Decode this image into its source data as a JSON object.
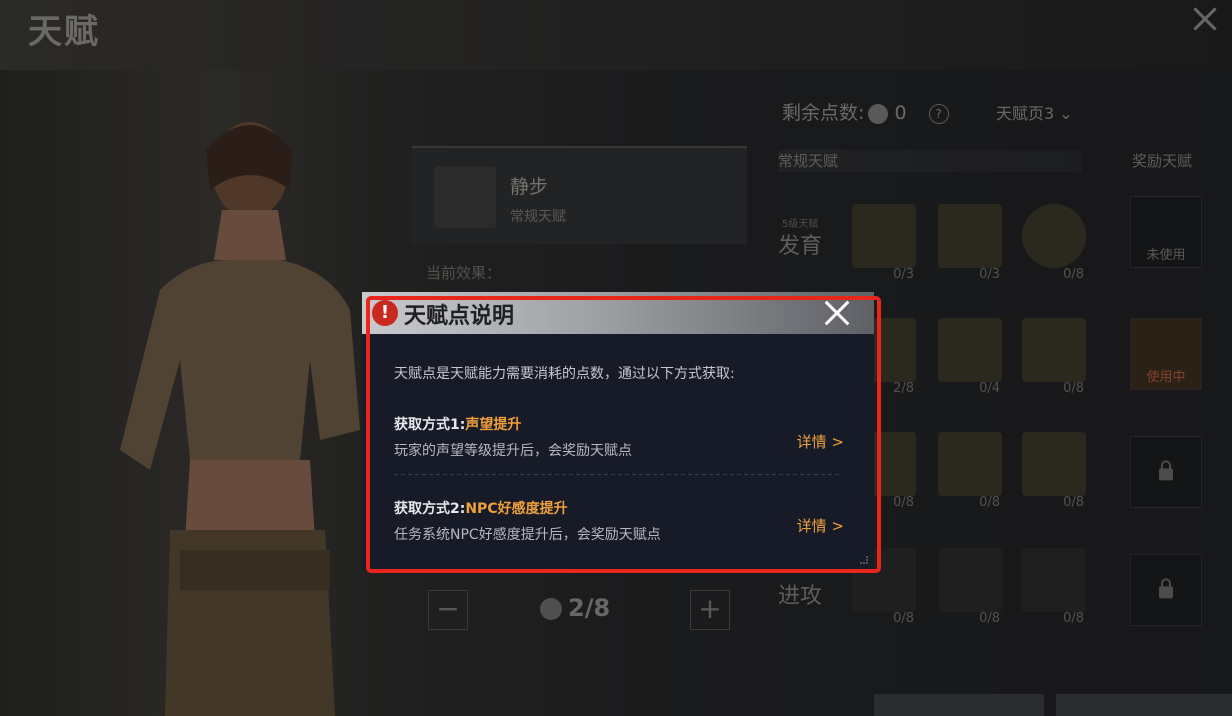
{
  "page": {
    "title": "天赋"
  },
  "talent": {
    "name": "静步",
    "type": "常规天赋",
    "effect_label": "当前效果："
  },
  "stepper": {
    "value": "2/8",
    "minus": "−",
    "plus": "+"
  },
  "right_panel": {
    "remaining_label": "剩余点数:",
    "remaining_value": "0",
    "help": "?",
    "page_select": "天赋页3",
    "section_normal": "常规天赋",
    "section_reward": "奖励天赋",
    "rows": [
      {
        "label": "发育",
        "sub": "5级天赋"
      },
      {
        "label": "进攻"
      }
    ],
    "tiles": [
      {
        "count": "0/3"
      },
      {
        "count": "0/3"
      },
      {
        "count": "0/8"
      },
      {
        "count": "2/8"
      },
      {
        "count": "0/4"
      },
      {
        "count": "0/8"
      },
      {
        "count": "0/8"
      },
      {
        "count": "0/8"
      },
      {
        "count": "0/8"
      },
      {
        "count": "0/8"
      },
      {
        "count": "0/8"
      },
      {
        "count": "0/8"
      }
    ],
    "reward_tiles": [
      {
        "text": "未使用"
      },
      {
        "text": "使用中"
      },
      {
        "text": ""
      },
      {
        "text": ""
      }
    ]
  },
  "dialog": {
    "title": "天赋点说明",
    "warn_icon": "!",
    "intro": "天赋点是天赋能力需要消耗的点数，通过以下方式获取:",
    "methods": [
      {
        "prefix": "获取方式1:",
        "highlight": "声望提升",
        "desc": "玩家的声望等级提升后，会奖励天赋点",
        "detail": "详情 >"
      },
      {
        "prefix": "获取方式2:",
        "highlight": "NPC好感度提升",
        "desc": "任务系统NPC好感度提升后，会奖励天赋点",
        "detail": "详情 >"
      }
    ]
  },
  "colors": {
    "accent": "#f0a03a",
    "highlight_border": "#e8261c",
    "dialog_bg": "#171a27"
  }
}
